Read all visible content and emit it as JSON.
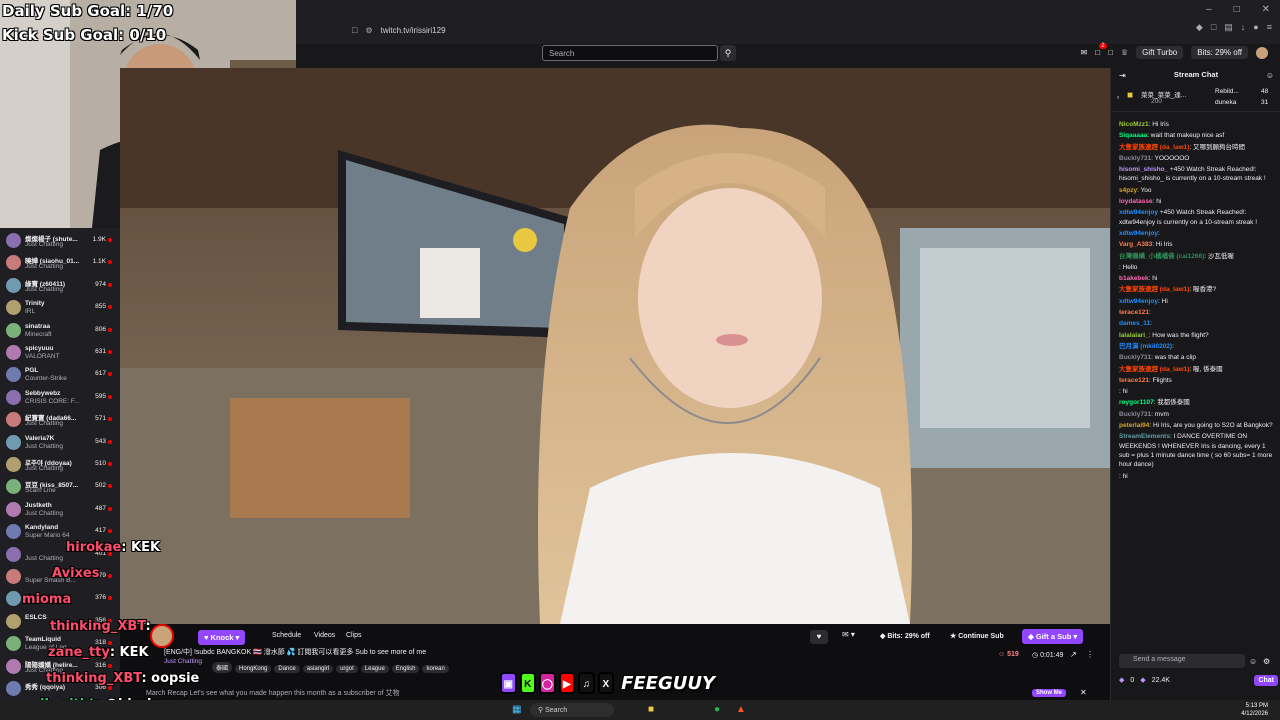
{
  "browser": {
    "url": "twitch.tv/irissiri129",
    "search_placeholder": "Search"
  },
  "header": {
    "notification_count": "2",
    "gift_turbo": "Gift Turbo",
    "bits": "Bits: 29% off"
  },
  "overlay": {
    "daily_goal": "Daily Sub Goal: 1/70",
    "kick_goal": "Kick Sub Goal: 0/10"
  },
  "sidebar": {
    "channels": [
      {
        "name": "燦燦楊子 (shute...",
        "game": "Just Chatting",
        "viewers": "1.9K"
      },
      {
        "name": "曉嬅 (siaohu_01...",
        "game": "Just Chatting",
        "viewers": "1.1K"
      },
      {
        "name": "綠寶 (z60411)",
        "game": "Just Chatting",
        "viewers": "974"
      },
      {
        "name": "Trinity",
        "game": "IRL",
        "viewers": "855"
      },
      {
        "name": "sinatraa",
        "game": "Minecraft",
        "viewers": "806"
      },
      {
        "name": "spicyuuu",
        "game": "VALORANT",
        "viewers": "631"
      },
      {
        "name": "PGL",
        "game": "Counter-Strike",
        "viewers": "617"
      },
      {
        "name": "Sebbywebz",
        "game": "CRISIS CORE: F...",
        "viewers": "595"
      },
      {
        "name": "紀寶寶 (dada66...",
        "game": "Just Chatting",
        "viewers": "571"
      },
      {
        "name": "Valeria7K",
        "game": "Just Chatting",
        "viewers": "543"
      },
      {
        "name": "로주야 (ddoyaa)",
        "game": "Just Chatting",
        "viewers": "510"
      },
      {
        "name": "豆豆 (kiss_8507...",
        "game": "Scam Line",
        "viewers": "502"
      },
      {
        "name": "Justketh",
        "game": "Just Chatting",
        "viewers": "487"
      },
      {
        "name": "Kandyland",
        "game": "Super Mario 64",
        "viewers": "417"
      },
      {
        "name": "",
        "game": "Just Chatting",
        "viewers": "401"
      },
      {
        "name": "",
        "game": "Super Smash B...",
        "viewers": "379"
      },
      {
        "name": "",
        "game": "",
        "viewers": "376"
      },
      {
        "name": "ESLCS",
        "game": "",
        "viewers": "356"
      },
      {
        "name": "TeamLiquid",
        "game": "League of Leg...",
        "viewers": "318"
      },
      {
        "name": "陽陽嬌嬌 (helire...",
        "game": "Just Chatting",
        "viewers": "316"
      },
      {
        "name": "秀秀 (qqoiya)",
        "game": "",
        "viewers": "306"
      }
    ]
  },
  "overlay_chat": [
    {
      "user": "hirokae",
      "text": ": KEK"
    },
    {
      "user": "Avixes",
      "text": ""
    },
    {
      "user": "mioma",
      "text": ""
    },
    {
      "user": "thinking_XBT",
      "text": ":"
    },
    {
      "user": "zane_tty",
      "text": ": KEK"
    },
    {
      "user": "thinking_XBT",
      "text": ": oopsie"
    },
    {
      "user": "jb_eitht",
      "text": ": @hirokae"
    }
  ],
  "info_bar": {
    "knock": "Knock",
    "schedule": "Schedule",
    "videos": "Videos",
    "clips": "Clips",
    "bits_off": "Bits: 29% off",
    "continue_sub": "Continue Sub",
    "gift_sub": "Gift a Sub",
    "title": "[ENG/中] !subdc BANGKOK 🇹🇭 潑水節 💦 訂閱我可以看更多 Sub to see more of me",
    "category": "Just Chatting",
    "tags": [
      "泰國",
      "HongKong",
      "Dance",
      "asiangirl",
      "urgot",
      "League",
      "English",
      "korean"
    ],
    "viewers": "519",
    "uptime": "0:01:49",
    "recap": "March Recap Let's see what you made happen this month as a subscriber of 艾物",
    "show_me": "Show Me"
  },
  "chat": {
    "title": "Stream Chat",
    "pinned_left": "菜菜_菜菜_達...",
    "pinned_left_count": "200",
    "pinned_right_1": "Rebild...",
    "pinned_right_1_count": "48",
    "pinned_right_2": "duneka",
    "pinned_right_2_count": "31",
    "messages": [
      {
        "user": "NicoMzz1",
        "text": ": Hi Iris",
        "color": "#9acd32"
      },
      {
        "user": "Siqaaaaa",
        "text": ": wait that makeup nice asf",
        "color": "#00ff7f"
      },
      {
        "user": "大隻家族連趕 (da_law1)",
        "text": ": 又哪到願夠台時間",
        "color": "#ff4500"
      },
      {
        "user": "Buckly731",
        "text": ": YOOOOOO",
        "color": "#8a8a95"
      },
      {
        "user": "hisomi_shisho_",
        "text": " +450 Watch Streak Reached!: hisomi_shisho_ is currently on a 10-stream streak !",
        "color": "#bf94ff"
      },
      {
        "user": "s4pzy",
        "text": ": Yoo",
        "color": "#daa520"
      },
      {
        "user": "loydatasse",
        "text": ": hi",
        "color": "#ff69b4"
      },
      {
        "user": "xdtw94enjoy",
        "text": " +450 Watch Streak Reached!: xdtw94enjoy is currently on a 10-stream streak !",
        "color": "#1e90ff"
      },
      {
        "user": "xdtw94enjoy",
        "text": ":",
        "color": "#1e90ff"
      },
      {
        "user": "Varg_A383",
        "text": ": Hi Iris",
        "color": "#ff7f50"
      },
      {
        "user": "台灣機構_小橘橘佛 (cai1266)",
        "text": ": 沙瓦低喔",
        "color": "#2e8b57"
      },
      {
        "user": "",
        "text": ": Hello",
        "color": "#ff0000"
      },
      {
        "user": "b1akebek",
        "text": ": hi",
        "color": "#ff69b4"
      },
      {
        "user": "大隻家族連趕 (da_law1)",
        "text": ": 喔香港?",
        "color": "#ff4500"
      },
      {
        "user": "xdtw94enjoy",
        "text": ": Hi",
        "color": "#1e90ff"
      },
      {
        "user": "terace121",
        "text": ":",
        "color": "#ff7f50"
      },
      {
        "user": "dames_11",
        "text": ":",
        "color": "#1e90ff"
      },
      {
        "user": "lalalalari_",
        "text": ": How was the flight?",
        "color": "#9acd32"
      },
      {
        "user": "巴月演 (mkii0202)",
        "text": ":",
        "color": "#1e90ff"
      },
      {
        "user": "Buckly731",
        "text": ": was that a clip",
        "color": "#8a8a95"
      },
      {
        "user": "大隻家族連趕 (da_law1)",
        "text": ": 喔, 係泰國",
        "color": "#ff4500"
      },
      {
        "user": "terace121",
        "text": ": Flights",
        "color": "#ff7f50"
      },
      {
        "user": "",
        "text": ": hi",
        "color": "#ff4500"
      },
      {
        "user": "roygor1107",
        "text": ": 我都係泰國",
        "color": "#00ff7f"
      },
      {
        "user": "Buckly731",
        "text": ": mvm",
        "color": "#8a8a95"
      },
      {
        "user": "peterlai94",
        "text": ": Hi Iris, are you going to S2O at Bangkok?",
        "color": "#daa520"
      },
      {
        "user": "StreamElements",
        "text": ": I DANCE OVERTIME ON WEEKENDS ! WHENEVER Iris is dancing, every 1 sub = plus 1 minute dance time ( so 60 subs= 1 more hour dance)",
        "color": "#5f9ea0"
      },
      {
        "user": "",
        "text": ": hi",
        "color": "#ff4500"
      }
    ],
    "input_placeholder": "Send a message",
    "points": "22.4K",
    "points_prefix": "0",
    "chat_button": "Chat"
  },
  "socials": {
    "brand": "FEEGUUY"
  },
  "taskbar": {
    "search": "Search",
    "time": "5:13 PM",
    "date": "4/12/2026"
  }
}
